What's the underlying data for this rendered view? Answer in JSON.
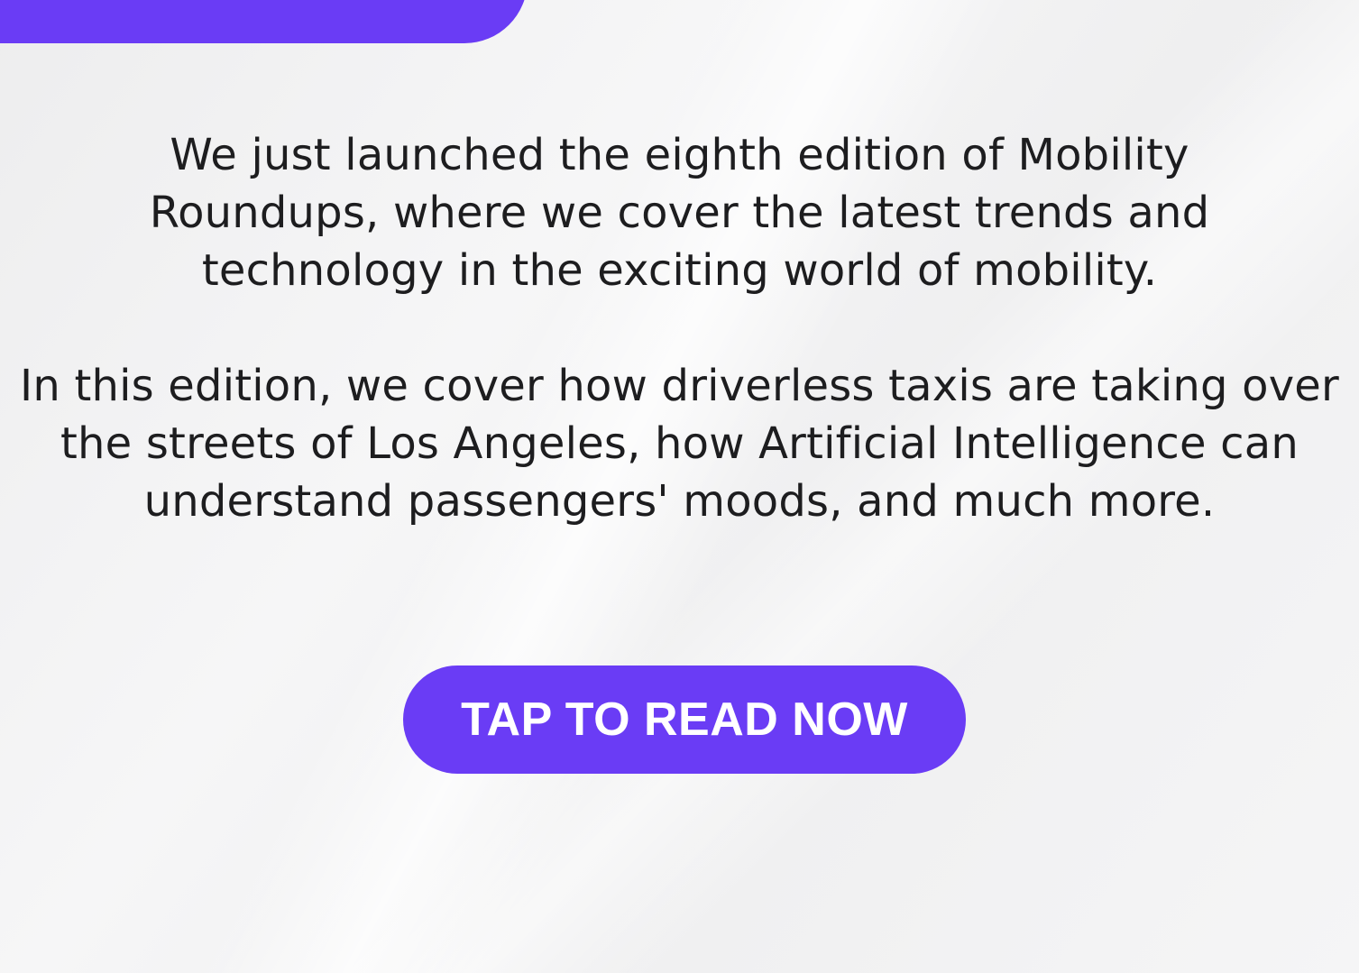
{
  "colors": {
    "accent": "#6a3cf5",
    "text": "#1d1d1f",
    "background": "#f2f2f3",
    "button_text": "#ffffff"
  },
  "content": {
    "paragraph_1": "We just launched the eighth edition of Mobility Roundups, where we cover the latest trends and technology in the exciting world of mobility.",
    "paragraph_2": "In this edition, we cover how driverless taxis are taking over the streets of Los Angeles, how Artificial Intelligence can understand passengers' moods, and much more."
  },
  "cta": {
    "label": "TAP TO READ NOW"
  }
}
